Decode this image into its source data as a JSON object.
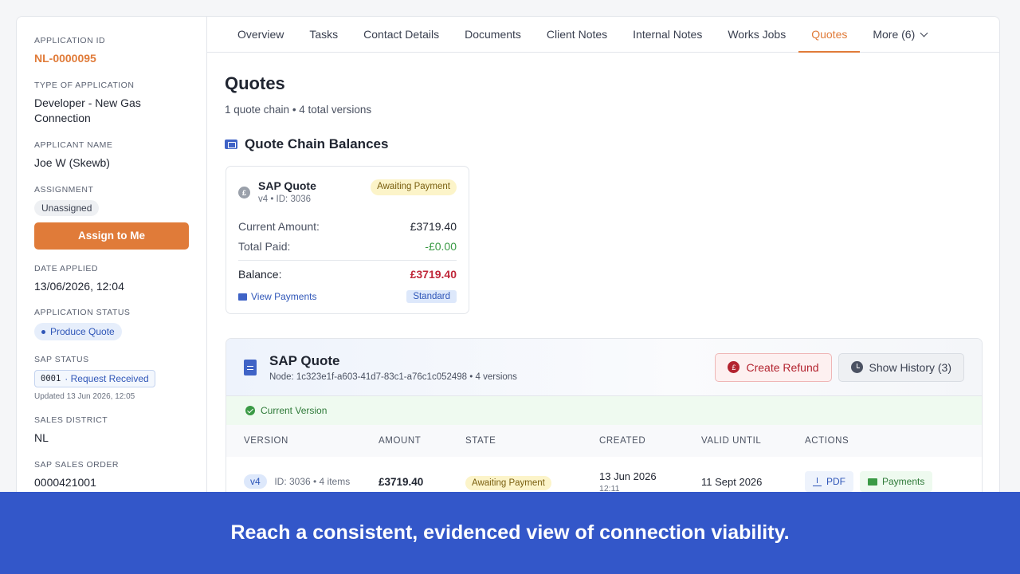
{
  "sidebar": {
    "application_id_label": "APPLICATION ID",
    "application_id": "NL-0000095",
    "type_label": "TYPE OF APPLICATION",
    "type": "Developer - New Gas Connection",
    "applicant_label": "APPLICANT NAME",
    "applicant": "Joe W (Skewb)",
    "assignment_label": "ASSIGNMENT",
    "assignment": "Unassigned",
    "assign_button": "Assign to Me",
    "date_label": "DATE APPLIED",
    "date": "13/06/2026, 12:04",
    "status_label": "APPLICATION STATUS",
    "status": "Produce Quote",
    "sap_status_label": "SAP STATUS",
    "sap_code": "0001",
    "sap_status": "· Request Received",
    "sap_updated": "Updated 13 Jun 2026, 12:05",
    "district_label": "SALES DISTRICT",
    "district": "NL",
    "sales_order_label": "SAP SALES ORDER",
    "sales_order": "0000421001"
  },
  "tabs": [
    "Overview",
    "Tasks",
    "Contact Details",
    "Documents",
    "Client Notes",
    "Internal Notes",
    "Works Jobs",
    "Quotes",
    "More (6)"
  ],
  "page": {
    "title": "Quotes",
    "subtitle": "1 quote chain • 4 total versions",
    "balances_heading": "Quote Chain Balances"
  },
  "balance_card": {
    "title": "SAP Quote",
    "meta": "v4 • ID: 3036",
    "status": "Awaiting Payment",
    "current_label": "Current Amount:",
    "current": "£3719.40",
    "paid_label": "Total Paid:",
    "paid": "-£0.00",
    "balance_label": "Balance:",
    "balance": "£3719.40",
    "view_payments": "View Payments",
    "type": "Standard"
  },
  "quote": {
    "title": "SAP Quote",
    "node": "Node: 1c323e1f-a603-41d7-83c1-a76c1c052498 • 4 versions",
    "refund_button": "Create Refund",
    "history_button": "Show History (3)",
    "current_version": "Current Version",
    "headers": [
      "VERSION",
      "AMOUNT",
      "STATE",
      "CREATED",
      "VALID UNTIL",
      "ACTIONS"
    ],
    "rows": [
      {
        "version": "v4",
        "meta": "ID: 3036 • 4 items",
        "amount": "£3719.40",
        "state": "Awaiting Payment",
        "created_date": "13 Jun 2026",
        "created_time": "12:11",
        "valid_until": "11 Sept 2026",
        "pdf": "PDF",
        "payments": "Payments"
      }
    ]
  },
  "banner": "Reach a consistent, evidenced view of connection viability.",
  "colors": {
    "accent": "#e07b39",
    "primary": "#3357c9",
    "danger": "#b3232f",
    "success": "#3a9a45"
  }
}
